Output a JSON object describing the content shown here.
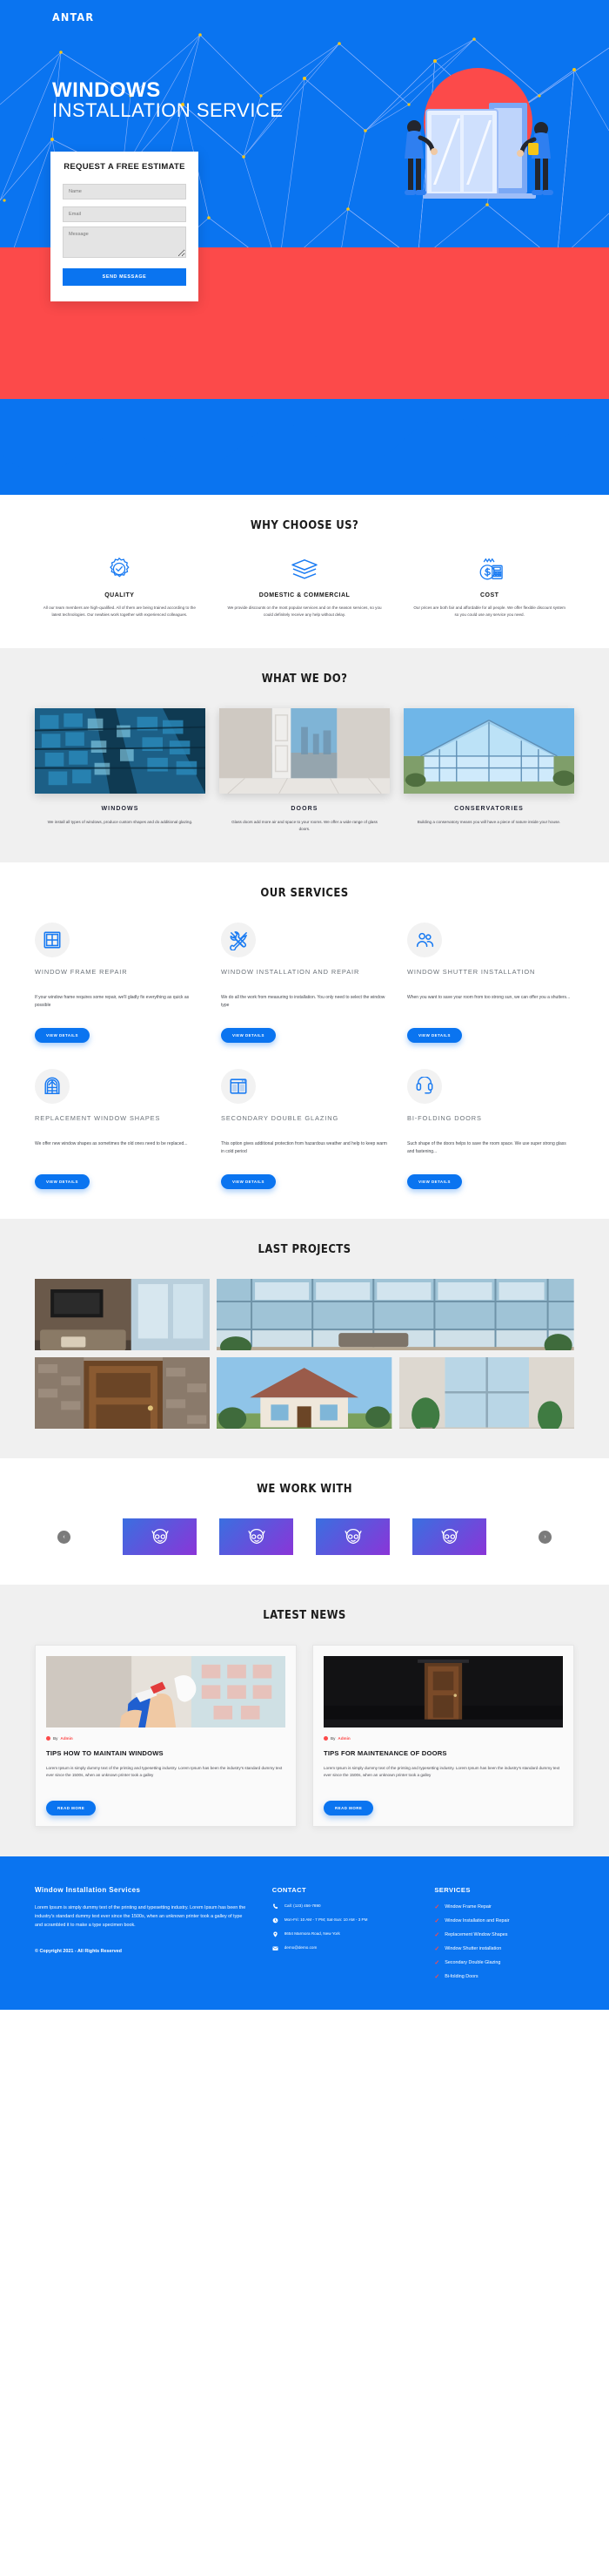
{
  "brand": "ANTAR",
  "hero": {
    "title_line1": "WINDOWS",
    "title_line2": "INSTALLATION SERVICE",
    "form": {
      "heading": "REQUEST A FREE ESTIMATE",
      "name_placeholder": "Name",
      "email_placeholder": "Email",
      "message_placeholder": "Message",
      "submit_label": "SEND MESSAGE"
    },
    "colors": {
      "blue": "#0a74f0",
      "red": "#fc4a4a"
    }
  },
  "why": {
    "title": "WHY CHOOSE US?",
    "items": [
      {
        "icon": "quality-badge-icon",
        "heading": "QUALITY",
        "text": "All our team members are high-qualified. All of them are being trained according to the latest technologies. Our newbies work together with experienced colleagues."
      },
      {
        "icon": "layers-icon",
        "heading": "DOMESTIC & COMMERCIAL",
        "text": "We provide discounts on the most popular services and on the season services, so you could definitely receive any help without delay."
      },
      {
        "icon": "money-calculator-icon",
        "heading": "COST",
        "text": "Our prices are both fair and affordable for all people. We offer flexible discount system so you could use any service you need."
      }
    ]
  },
  "what_we_do": {
    "title": "WHAT WE DO?",
    "items": [
      {
        "image": "glass-skyscraper-photo",
        "heading": "WINDOWS",
        "text": "We install all types of windows, produce custom shapes and do additional glazing."
      },
      {
        "image": "open-white-door-photo",
        "heading": "DOORS",
        "text": "Glass doors add more air and space to your rooms. We offer a wide range of glass doors."
      },
      {
        "image": "glass-conservatory-photo",
        "heading": "CONSERVATORIES",
        "text": "Building a conservatory means you will have a piece of nature inside your house."
      }
    ]
  },
  "services": {
    "title": "OUR SERVICES",
    "button_label": "VIEW DETAILS",
    "items": [
      {
        "icon": "window-grid-icon",
        "heading": "WINDOW FRAME REPAIR",
        "text": "If your window frame requires some repair, we'll gladly fix everything as quick as possible"
      },
      {
        "icon": "tools-wrench-screwdriver-icon",
        "heading": "WINDOW INSTALLATION AND REPAIR",
        "text": "We do all the work from measuring to installation. You only need to select the window type"
      },
      {
        "icon": "shutter-people-icon",
        "heading": "WINDOW SHUTTER INSTALLATION",
        "text": "When you want to save your room from too strong sun, we can offer you a shutters..."
      },
      {
        "icon": "arched-window-icon",
        "heading": "REPLACEMENT WINDOW SHAPES",
        "text": "We offer new window shapes as sometimes the old ones need to be replaced..."
      },
      {
        "icon": "double-glazing-icon",
        "heading": "SECONDARY DOUBLE GLAZING",
        "text": "This option gives additional protection from hazardous weather and help to keep warm in cold period"
      },
      {
        "icon": "bifolding-door-icon",
        "heading": "BI-FOLDING DOORS",
        "text": "Such shape of the doors helps to save the room space. We use super strong glass and fastening..."
      }
    ]
  },
  "projects": {
    "title": "LAST PROJECTS",
    "items": [
      {
        "image": "modern-living-room-photo"
      },
      {
        "image": "glass-atrium-interior-photo"
      },
      {
        "image": "wooden-front-door-photo"
      },
      {
        "image": "suburban-house-photo"
      },
      {
        "image": "bright-room-with-plant-photo"
      }
    ]
  },
  "partners": {
    "title": "WE WORK WITH",
    "prev_label": "‹",
    "next_label": "›",
    "logos": [
      {
        "icon": "owl-mascot-logo"
      },
      {
        "icon": "owl-mascot-logo"
      },
      {
        "icon": "owl-mascot-logo"
      },
      {
        "icon": "owl-mascot-logo"
      }
    ]
  },
  "news": {
    "title": "LATEST NEWS",
    "button_label": "READ MORE",
    "by_prefix": "By",
    "items": [
      {
        "image": "cleaning-window-photo",
        "author": "Admin",
        "heading": "TIPS HOW TO MAINTAIN WINDOWS",
        "text": "Lorem Ipsum is simply dummy text of the printing and typesetting industry. Lorem Ipsum has been the industry's standard dummy text ever since the 1500s, when an unknown printer took a galley"
      },
      {
        "image": "dark-room-wooden-door-photo",
        "author": "Admin",
        "heading": "TIPS FOR MAINTENANCE OF DOORS",
        "text": "Lorem Ipsum is simply dummy text of the printing and typesetting industry. Lorem Ipsum has been the industry's standard dummy text ever since the 1500s, when an unknown printer took a galley"
      }
    ]
  },
  "footer": {
    "about_heading": "Window Installation Services",
    "about_text": "Lorem Ipsum is simply dummy text of the printing and typesetting industry. Lorem Ipsum has been the industry's standard dummy text ever since the 1500s, when an unknown printer took a galley of type and scrambled it to make a type specimen book.",
    "copyright": "© Copyright 2021 - All Rights Reserved",
    "contact_heading": "CONTACT",
    "contact_items": [
      {
        "icon": "phone-icon",
        "text": "Call: (123) 456-7890"
      },
      {
        "icon": "clock-icon",
        "text": "Mon-Fri: 10 AM - 7 PM; Sat-Sun: 10 AM - 3 PM"
      },
      {
        "icon": "map-pin-icon",
        "text": "8654 Marmora Road, New York"
      },
      {
        "icon": "envelope-icon",
        "text": "demo@demo.com"
      }
    ],
    "services_heading": "SERVICES",
    "services_items": [
      "Window Frame Repair",
      "Window Installation and Repair",
      "Replacement Window Shapes",
      "Window Shutter installation",
      "Secondary Double Glazing",
      "Bi-folding Doors"
    ]
  }
}
